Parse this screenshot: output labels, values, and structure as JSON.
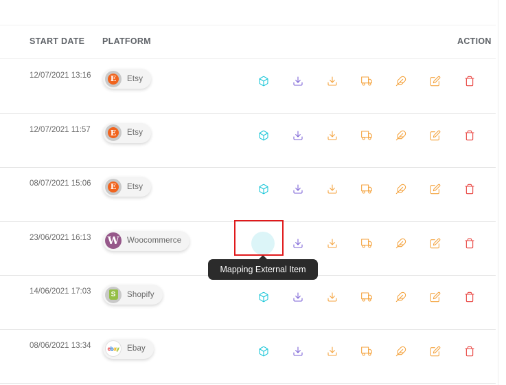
{
  "header": {
    "start_date": "START DATE",
    "platform": "PLATFORM",
    "action": "ACTION"
  },
  "rows": [
    {
      "start_date": "12/07/2021 13:16",
      "platform": "Etsy",
      "platform_logo": "etsy-logo"
    },
    {
      "start_date": "12/07/2021 11:57",
      "platform": "Etsy",
      "platform_logo": "etsy-logo"
    },
    {
      "start_date": "08/07/2021 15:06",
      "platform": "Etsy",
      "platform_logo": "etsy-logo"
    },
    {
      "start_date": "23/06/2021 16:13",
      "platform": "Woocommerce",
      "platform_logo": "woocommerce-logo"
    },
    {
      "start_date": "14/06/2021 17:03",
      "platform": "Shopify",
      "platform_logo": "shopify-logo"
    },
    {
      "start_date": "08/06/2021 13:34",
      "platform": "Ebay",
      "platform_logo": "ebay-logo"
    }
  ],
  "actions": [
    {
      "name": "mapping-external-item-button",
      "icon": "cube-icon",
      "color": "#19c6d8"
    },
    {
      "name": "import-button",
      "icon": "download-icon",
      "color": "#7b61d6"
    },
    {
      "name": "download-button",
      "icon": "download-icon",
      "color": "#f4a23c"
    },
    {
      "name": "shipping-button",
      "icon": "truck-icon",
      "color": "#f4a23c"
    },
    {
      "name": "feather-button",
      "icon": "feather-icon",
      "color": "#f4a23c"
    },
    {
      "name": "edit-button",
      "icon": "edit-icon",
      "color": "#f4a23c"
    },
    {
      "name": "delete-button",
      "icon": "trash-icon",
      "color": "#e8403c"
    }
  ],
  "tooltip": {
    "text": "Mapping External Item"
  },
  "highlight": {
    "row_index": 3,
    "action": "mapping-external-item-button",
    "color": "#e0191b"
  },
  "ebay_letters": [
    "e",
    "b",
    "a",
    "y"
  ],
  "woo_letter": "W",
  "etsy_letter": "E",
  "shopify_letter": "S"
}
